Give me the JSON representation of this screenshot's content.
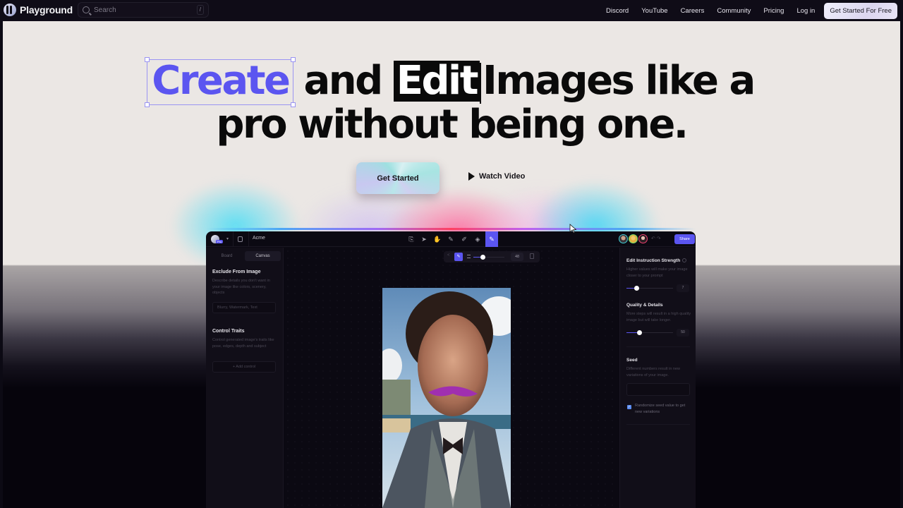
{
  "topbar": {
    "brand": "Playground",
    "search_placeholder": "Search",
    "search_shortcut": "/",
    "nav_links": [
      "Discord",
      "YouTube",
      "Careers",
      "Community",
      "Pricing",
      "Log in"
    ],
    "cta": "Get Started For Free"
  },
  "hero": {
    "headline_word_create": "Create",
    "headline_and": " and ",
    "headline_word_edit": "Edit",
    "headline_rest_line1": "Images like a",
    "headline_line2": "pro without being one.",
    "primary_button": "Get Started",
    "secondary_button": "Watch Video",
    "accent_color": "#5b55f0"
  },
  "app": {
    "workspace_badge": "Pro",
    "project_name": "Acme",
    "toolbar_icons": [
      "image-upload-icon",
      "select-arrow-icon",
      "hand-icon",
      "edit-image-icon",
      "pencil-icon",
      "fill-icon",
      "brush-icon"
    ],
    "share_label": "Share",
    "left_panel": {
      "tabs": [
        "Board",
        "Canvas"
      ],
      "active_tab": "Canvas",
      "exclude": {
        "title": "Exclude From Image",
        "description": "Describe details you don't want in your image like colors, scenery, objects",
        "input_placeholder": "Blurry, Watermark, Text"
      },
      "control_traits": {
        "title": "Control Traits",
        "description": "Control generated image's traits like pose, edges, depth and subject",
        "add_label": "+ Add control"
      }
    },
    "brush_bar": {
      "size_value": "48",
      "size_fraction": 0.3
    },
    "right_panel": {
      "edit_strength": {
        "title": "Edit Instruction Strength",
        "description": "Higher values will make your image closer to your prompt",
        "value": "7",
        "fraction": 0.22
      },
      "quality": {
        "title": "Quality & Details",
        "description": "More steps will result in a high quality image but will take longer.",
        "value": "50",
        "fraction": 0.28
      },
      "seed": {
        "title": "Seed",
        "description": "Different numbers result in new variations of your image.",
        "randomize_label": "Randomize seed value to get new variations",
        "randomize_checked": true
      }
    }
  }
}
